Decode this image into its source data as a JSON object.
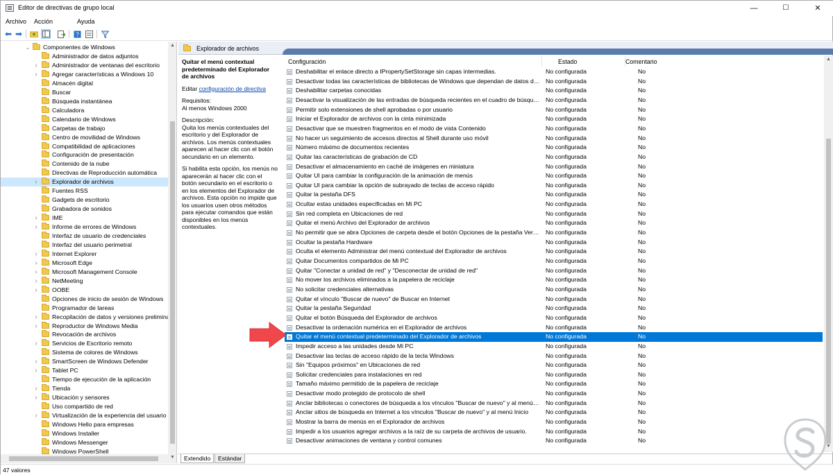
{
  "window": {
    "title": "Editor de directivas de grupo local",
    "minimize": "—",
    "maximize": "☐",
    "close": "✕"
  },
  "menu": [
    "Archivo",
    "Acción",
    "Ayuda"
  ],
  "tree": {
    "root_label": "Componentes de Windows",
    "items": [
      "Administrador de datos adjuntos",
      "Administrador de ventanas del escritorio",
      "Agregar características a Windows 10",
      "Almacén digital",
      "Buscar",
      "Búsqueda instantánea",
      "Calculadora",
      "Calendario de Windows",
      "Carpetas de trabajo",
      "Centro de movilidad de Windows",
      "Compatibilidad de aplicaciones",
      "Configuración de presentación",
      "Contenido de la nube",
      "Directivas de Reproducción automática",
      "Explorador de archivos",
      "Fuentes RSS",
      "Gadgets de escritorio",
      "Grabadora de sonidos",
      "IME",
      "Informe de errores de Windows",
      "Interfaz de usuario de credenciales",
      "Interfaz del usuario perimetral",
      "Internet Explorer",
      "Microsoft Edge",
      "Microsoft Management Console",
      "NetMeeting",
      "OOBE",
      "Opciones de inicio de sesión de Windows",
      "Programador de tareas",
      "Recopilación de datos y versiones prelimina",
      "Reproductor de Windows Media",
      "Revocación de archivos",
      "Servicios de Escritorio remoto",
      "Sistema de colores de Windows",
      "SmartScreen de Windows Defender",
      "Tablet PC",
      "Tiempo de ejecución de la aplicación",
      "Tienda",
      "Ubicación y sensores",
      "Uso compartido de red",
      "Virtualización de la experiencia del usuario d",
      "Windows Hello para empresas",
      "Windows Installer",
      "Windows Messenger",
      "Windows PowerShell"
    ],
    "expandable": [
      false,
      true,
      true,
      false,
      false,
      false,
      false,
      false,
      false,
      false,
      false,
      false,
      false,
      false,
      true,
      false,
      false,
      false,
      true,
      true,
      false,
      false,
      true,
      true,
      true,
      true,
      true,
      false,
      false,
      true,
      true,
      false,
      true,
      false,
      true,
      true,
      false,
      true,
      true,
      false,
      true,
      false,
      false,
      false,
      false
    ],
    "selected_index": 14
  },
  "panel": {
    "header": "Explorador de archivos"
  },
  "description": {
    "title": "Quitar el menú contextual predeterminado del Explorador de archivos",
    "edit_prefix": "Editar ",
    "edit_link": "configuración de directiva",
    "requirements_label": "Requisitos:",
    "requirements_value": "Al menos Windows 2000",
    "description_label": "Descripción:",
    "p1": "Quita los menús contextuales del escritorio y del Explorador de archivos. Los menús contextuales aparecen al hacer clic con el botón secundario en un elemento.",
    "p2": "Si habilita esta opción, los menús no aparecerán al hacer clic con el botón secundario en el escritorio o en los elementos del Explorador de archivos. Esta opción no impide que los usuarios usen otros métodos para ejecutar comandos que están disponibles en los menús contextuales."
  },
  "list": {
    "columns": {
      "setting": "Configuración",
      "state": "Estado",
      "comment": "Comentario"
    },
    "selected_index": 28,
    "rows": [
      {
        "name": "Deshabilitar el enlace directo a IPropertySetStorage sin capas intermedias.",
        "state": "No configurada",
        "comment": "No"
      },
      {
        "name": "Desactivar todas las características de bibliotecas de Windows que dependan de datos de archivos de índice",
        "state": "No configurada",
        "comment": "No"
      },
      {
        "name": "Deshabilitar carpetas conocidas",
        "state": "No configurada",
        "comment": "No"
      },
      {
        "name": "Desactivar la visualización de las entradas de búsqueda recientes en el cuadro de búsqueda del Explorador",
        "state": "No configurada",
        "comment": "No"
      },
      {
        "name": "Permitir solo extensiones de shell aprobadas o por usuario",
        "state": "No configurada",
        "comment": "No"
      },
      {
        "name": "Iniciar el Explorador de archivos con la cinta minimizada",
        "state": "No configurada",
        "comment": "No"
      },
      {
        "name": "Desactivar que se muestren fragmentos en el modo de vista Contenido",
        "state": "No configurada",
        "comment": "No"
      },
      {
        "name": "No hacer un seguimiento de accesos directos al Shell durante uso móvil",
        "state": "No configurada",
        "comment": "No"
      },
      {
        "name": "Número máximo de documentos recientes",
        "state": "No configurada",
        "comment": "No"
      },
      {
        "name": "Quitar las características de grabación de CD",
        "state": "No configurada",
        "comment": "No"
      },
      {
        "name": "Desactivar el almacenamiento en caché de imágenes en miniatura",
        "state": "No configurada",
        "comment": "No"
      },
      {
        "name": "Quitar UI para cambiar la configuración de la animación de menús",
        "state": "No configurada",
        "comment": "No"
      },
      {
        "name": "Quitar UI para cambiar la opción de subrayado de teclas de acceso rápido",
        "state": "No configurada",
        "comment": "No"
      },
      {
        "name": "Quitar la pestaña DFS",
        "state": "No configurada",
        "comment": "No"
      },
      {
        "name": "Ocultar estas unidades especificadas en Mi PC",
        "state": "No configurada",
        "comment": "No"
      },
      {
        "name": "Sin red completa en Ubicaciones de red",
        "state": "No configurada",
        "comment": "No"
      },
      {
        "name": "Quitar el menú Archivo del Explorador de archivos",
        "state": "No configurada",
        "comment": "No"
      },
      {
        "name": "No permitir que se abra Opciones de carpeta desde el botón Opciones de la pestaña Ver de la cinta",
        "state": "No configurada",
        "comment": "No"
      },
      {
        "name": "Ocultar la pestaña Hardware",
        "state": "No configurada",
        "comment": "No"
      },
      {
        "name": "Oculta el elemento Administrar del menú contextual del Explorador de archivos",
        "state": "No configurada",
        "comment": "No"
      },
      {
        "name": "Quitar Documentos compartidos de Mi PC",
        "state": "No configurada",
        "comment": "No"
      },
      {
        "name": "Quitar \"Conectar a unidad de red\" y \"Desconectar de unidad de red\"",
        "state": "No configurada",
        "comment": "No"
      },
      {
        "name": "No mover los archivos eliminados a la papelera de reciclaje",
        "state": "No configurada",
        "comment": "No"
      },
      {
        "name": "No solicitar credenciales alternativas",
        "state": "No configurada",
        "comment": "No"
      },
      {
        "name": "Quitar el vínculo \"Buscar de nuevo\" de Buscar en Internet",
        "state": "No configurada",
        "comment": "No"
      },
      {
        "name": "Quitar la pestaña Seguridad",
        "state": "No configurada",
        "comment": "No"
      },
      {
        "name": "Quitar el botón Búsqueda del Explorador de archivos",
        "state": "No configurada",
        "comment": "No"
      },
      {
        "name": "Desactivar la ordenación numérica en el Explorador de archivos",
        "state": "No configurada",
        "comment": "No"
      },
      {
        "name": "Quitar el menú contextual predeterminado del Explorador de archivos",
        "state": "No configurada",
        "comment": "No"
      },
      {
        "name": "Impedir acceso a las unidades desde Mi PC",
        "state": "No configurada",
        "comment": "No"
      },
      {
        "name": "Desactivar las teclas de acceso rápido de la tecla Windows",
        "state": "No configurada",
        "comment": "No"
      },
      {
        "name": "Sin \"Equipos próximos\" en Ubicaciones de red",
        "state": "No configurada",
        "comment": "No"
      },
      {
        "name": "Solicitar credenciales para instalaciones en red",
        "state": "No configurada",
        "comment": "No"
      },
      {
        "name": "Tamaño máximo permitido de la papelera de reciclaje",
        "state": "No configurada",
        "comment": "No"
      },
      {
        "name": "Desactivar modo protegido de protocolo de shell",
        "state": "No configurada",
        "comment": "No"
      },
      {
        "name": "Anclar bibliotecas o conectores de búsqueda a los vínculos \"Buscar de nuevo\" y al menú Inicio",
        "state": "No configurada",
        "comment": "No"
      },
      {
        "name": "Anclar sitios de búsqueda en Internet a los vínculos \"Buscar de nuevo\" y al menú Inicio",
        "state": "No configurada",
        "comment": "No"
      },
      {
        "name": "Mostrar la barra de menús en el Explorador de archivos",
        "state": "No configurada",
        "comment": "No"
      },
      {
        "name": "Impedir a los usuarios agregar archivos a la raíz de su carpeta de archivos de usuario.",
        "state": "No configurada",
        "comment": "No"
      },
      {
        "name": "Desactivar animaciones de ventana y control comunes",
        "state": "No configurada",
        "comment": "No"
      }
    ]
  },
  "tabs": [
    "Extendido",
    "Estándar"
  ],
  "status": "47 valores",
  "colors": {
    "selection": "#0078d7",
    "tree_selection": "#cce8ff",
    "header_band": "#5b7cab",
    "arrow": "#f0474b"
  }
}
